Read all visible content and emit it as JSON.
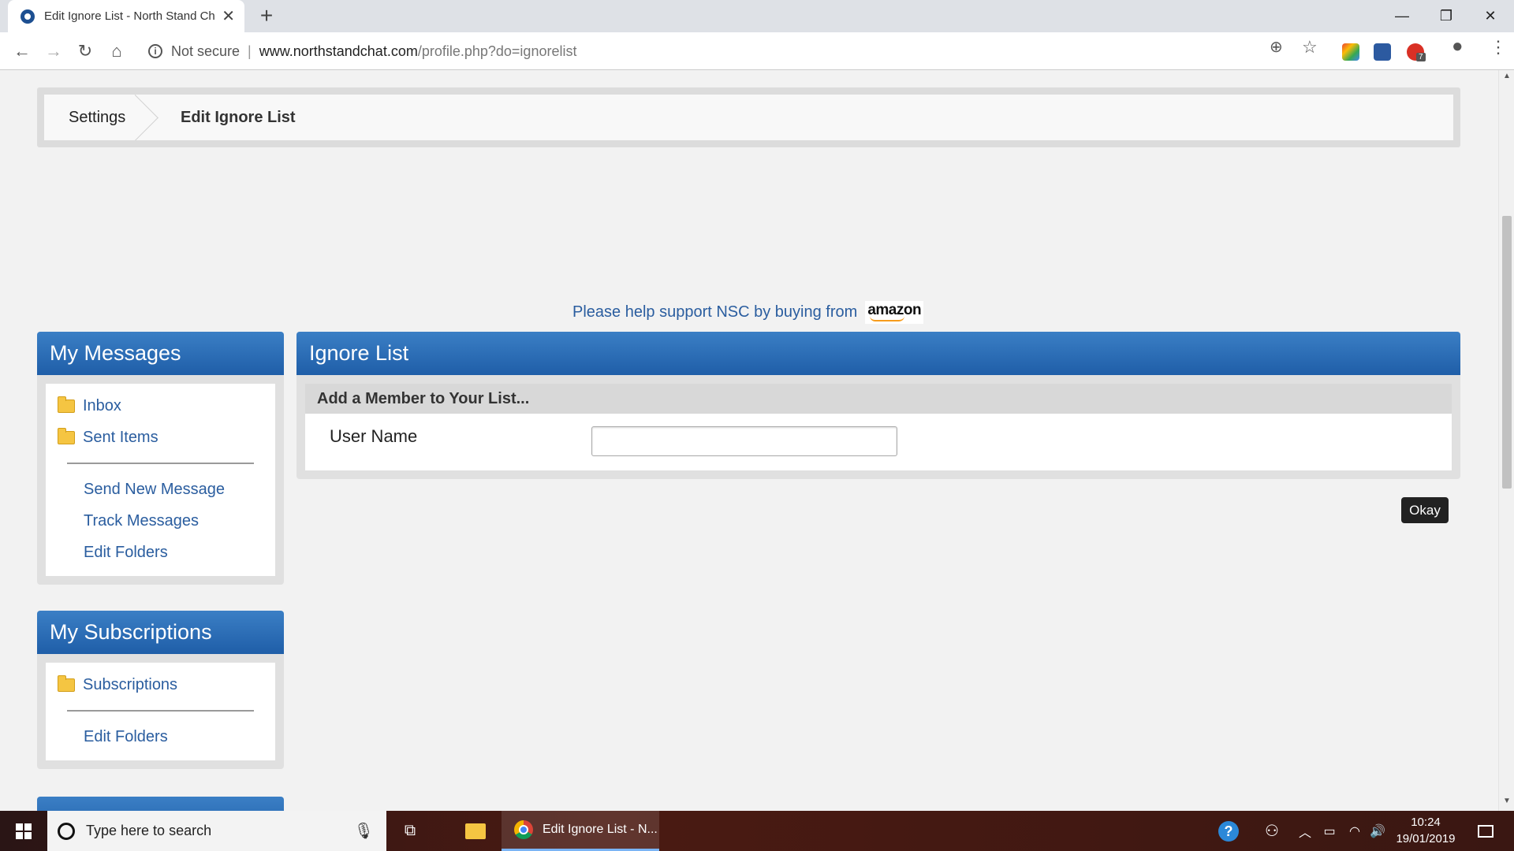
{
  "browser": {
    "tab_title": "Edit Ignore List - North Stand Ch",
    "tab_close": "✕",
    "new_tab": "+",
    "security_label": "Not secure",
    "separator": "|",
    "url_host": "www.northstandchat.com",
    "url_path": "/profile.php?do=ignorelist",
    "extension_badge": "7",
    "window_controls": {
      "minimize": "—",
      "maximize": "❐",
      "close": "✕"
    },
    "nav": {
      "back": "←",
      "forward": "→",
      "reload": "↻",
      "home": "⌂",
      "zoom": "⊕",
      "bookmark": "☆",
      "account": "●",
      "menu": "⋮"
    }
  },
  "breadcrumb": {
    "parent": "Settings",
    "current": "Edit Ignore List"
  },
  "ad": {
    "text": "Please help support NSC by buying from",
    "brand": "amazon"
  },
  "my_messages": {
    "title": "My Messages",
    "folders": [
      "Inbox",
      "Sent Items"
    ],
    "actions": [
      "Send New Message",
      "Track Messages",
      "Edit Folders"
    ]
  },
  "my_subscriptions": {
    "title": "My Subscriptions",
    "folders": [
      "Subscriptions"
    ],
    "actions": [
      "Edit Folders"
    ]
  },
  "ignore_list": {
    "title": "Ignore List",
    "subheader": "Add a Member to Your List...",
    "field_label": "User Name",
    "field_value": "",
    "submit_label": "Okay"
  },
  "taskbar": {
    "search_placeholder": "Type here to search",
    "active_app": "Edit Ignore List - N...",
    "time": "10:24",
    "date": "19/01/2019",
    "help_glyph": "?"
  },
  "colors": {
    "header_blue": "#1f5ea8",
    "link_blue": "#2a5d9f",
    "page_bg": "#f2f2f2"
  }
}
